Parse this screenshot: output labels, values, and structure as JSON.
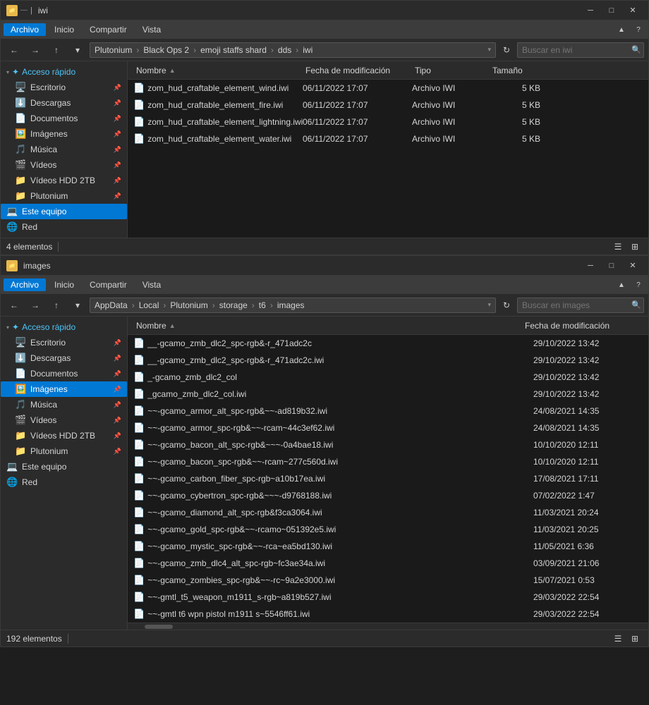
{
  "window1": {
    "title": "iwi",
    "menu": [
      "Archivo",
      "Inicio",
      "Compartir",
      "Vista"
    ],
    "breadcrumb": [
      "Plutonium",
      "Black Ops 2",
      "emoji staffs shard",
      "dds",
      "iwi"
    ],
    "columns": [
      "Nombre",
      "Fecha de modificación",
      "Tipo",
      "Tamaño"
    ],
    "files": [
      {
        "icon": "📄",
        "name": "zom_hud_craftable_element_wind.iwi",
        "date": "06/11/2022 17:07",
        "type": "Archivo IWI",
        "size": "5 KB"
      },
      {
        "icon": "📄",
        "name": "zom_hud_craftable_element_fire.iwi",
        "date": "06/11/2022 17:07",
        "type": "Archivo IWI",
        "size": "5 KB"
      },
      {
        "icon": "📄",
        "name": "zom_hud_craftable_element_lightning.iwi",
        "date": "06/11/2022 17:07",
        "type": "Archivo IWI",
        "size": "5 KB"
      },
      {
        "icon": "📄",
        "name": "zom_hud_craftable_element_water.iwi",
        "date": "06/11/2022 17:07",
        "type": "Archivo IWI",
        "size": "5 KB"
      }
    ],
    "status": "4 elementos",
    "sidebar": {
      "sections": [
        {
          "label": "Acceso rápido",
          "items": [
            {
              "icon": "🖥️",
              "label": "Escritorio",
              "pinned": true
            },
            {
              "icon": "⬇️",
              "label": "Descargas",
              "pinned": true
            },
            {
              "icon": "📄",
              "label": "Documentos",
              "pinned": true
            },
            {
              "icon": "🖼️",
              "label": "Imágenes",
              "pinned": true
            },
            {
              "icon": "🎵",
              "label": "Música",
              "pinned": true
            },
            {
              "icon": "🎬",
              "label": "Vídeos",
              "pinned": true
            },
            {
              "icon": "📁",
              "label": "Vídeos HDD 2TB",
              "pinned": true
            },
            {
              "icon": "📁",
              "label": "Plutonium",
              "pinned": true
            }
          ]
        },
        {
          "label": "Este equipo",
          "isItem": true,
          "active": false
        },
        {
          "label": "Red",
          "isItem": true,
          "active": false
        }
      ]
    }
  },
  "window2": {
    "title": "images",
    "menu": [
      "Archivo",
      "Inicio",
      "Compartir",
      "Vista"
    ],
    "breadcrumb": [
      "AppData",
      "Local",
      "Plutonium",
      "storage",
      "t6",
      "images"
    ],
    "columns": [
      "Nombre",
      "Fecha de modificación"
    ],
    "files": [
      {
        "icon": "📄",
        "name": "__-gcamo_zmb_dlc2_spc-rgb&-r_471adc2c",
        "date": "29/10/2022 13:42"
      },
      {
        "icon": "📄",
        "name": "__-gcamo_zmb_dlc2_spc-rgb&-r_471adc2c.iwi",
        "date": "29/10/2022 13:42"
      },
      {
        "icon": "📄",
        "name": "_-gcamo_zmb_dlc2_col",
        "date": "29/10/2022 13:42"
      },
      {
        "icon": "📄",
        "name": "_gcamo_zmb_dlc2_col.iwi",
        "date": "29/10/2022 13:42"
      },
      {
        "icon": "📄",
        "name": "~~-gcamo_armor_alt_spc-rgb&~~-ad819b32.iwi",
        "date": "24/08/2021 14:35"
      },
      {
        "icon": "📄",
        "name": "~~-gcamo_armor_spc-rgb&~~-rcam~44c3ef62.iwi",
        "date": "24/08/2021 14:35"
      },
      {
        "icon": "📄",
        "name": "~~-gcamo_bacon_alt_spc-rgb&~~~-0a4bae18.iwi",
        "date": "10/10/2020 12:11"
      },
      {
        "icon": "📄",
        "name": "~~-gcamo_bacon_spc-rgb&~~-rcam~277c560d.iwi",
        "date": "10/10/2020 12:11"
      },
      {
        "icon": "📄",
        "name": "~~-gcamo_carbon_fiber_spc-rgb~a10b17ea.iwi",
        "date": "17/08/2021 17:11"
      },
      {
        "icon": "📄",
        "name": "~~-gcamo_cybertron_spc-rgb&~~~-d9768188.iwi",
        "date": "07/02/2022 1:47"
      },
      {
        "icon": "📄",
        "name": "~~-gcamo_diamond_alt_spc-rgb&f3ca3064.iwi",
        "date": "11/03/2021 20:24"
      },
      {
        "icon": "📄",
        "name": "~~-gcamo_gold_spc-rgb&~~-rcamo~051392e5.iwi",
        "date": "11/03/2021 20:25"
      },
      {
        "icon": "📄",
        "name": "~~-gcamo_mystic_spc-rgb&~~-rca~ea5bd130.iwi",
        "date": "11/05/2021 6:36"
      },
      {
        "icon": "📄",
        "name": "~~-gcamo_zmb_dlc4_alt_spc-rgb~fc3ae34a.iwi",
        "date": "03/09/2021 21:06"
      },
      {
        "icon": "📄",
        "name": "~~-gcamo_zombies_spc-rgb&~~-rc~9a2e3000.iwi",
        "date": "15/07/2021 0:53"
      },
      {
        "icon": "📄",
        "name": "~~-gmtl_t5_weapon_m1911_s-rgb~a819b527.iwi",
        "date": "29/03/2022 22:54"
      },
      {
        "icon": "📄",
        "name": "~~-gmtl t6 wpn pistol m1911 s~5546ff61.iwi",
        "date": "29/03/2022 22:54"
      }
    ],
    "status": "192 elementos",
    "sidebar": {
      "sections": [
        {
          "label": "Acceso rápido",
          "items": [
            {
              "icon": "🖥️",
              "label": "Escritorio",
              "pinned": true
            },
            {
              "icon": "⬇️",
              "label": "Descargas",
              "pinned": true
            },
            {
              "icon": "📄",
              "label": "Documentos",
              "pinned": true
            },
            {
              "icon": "🖼️",
              "label": "Imágenes",
              "pinned": true,
              "active": true
            },
            {
              "icon": "🎵",
              "label": "Música",
              "pinned": true
            },
            {
              "icon": "🎬",
              "label": "Vídeos",
              "pinned": true
            },
            {
              "icon": "📁",
              "label": "Vídeos HDD 2TB",
              "pinned": true
            },
            {
              "icon": "📁",
              "label": "Plutonium",
              "pinned": true
            }
          ]
        },
        {
          "label": "Este equipo",
          "isItem": true,
          "active": false
        },
        {
          "label": "Red",
          "isItem": true,
          "active": false
        }
      ]
    }
  }
}
